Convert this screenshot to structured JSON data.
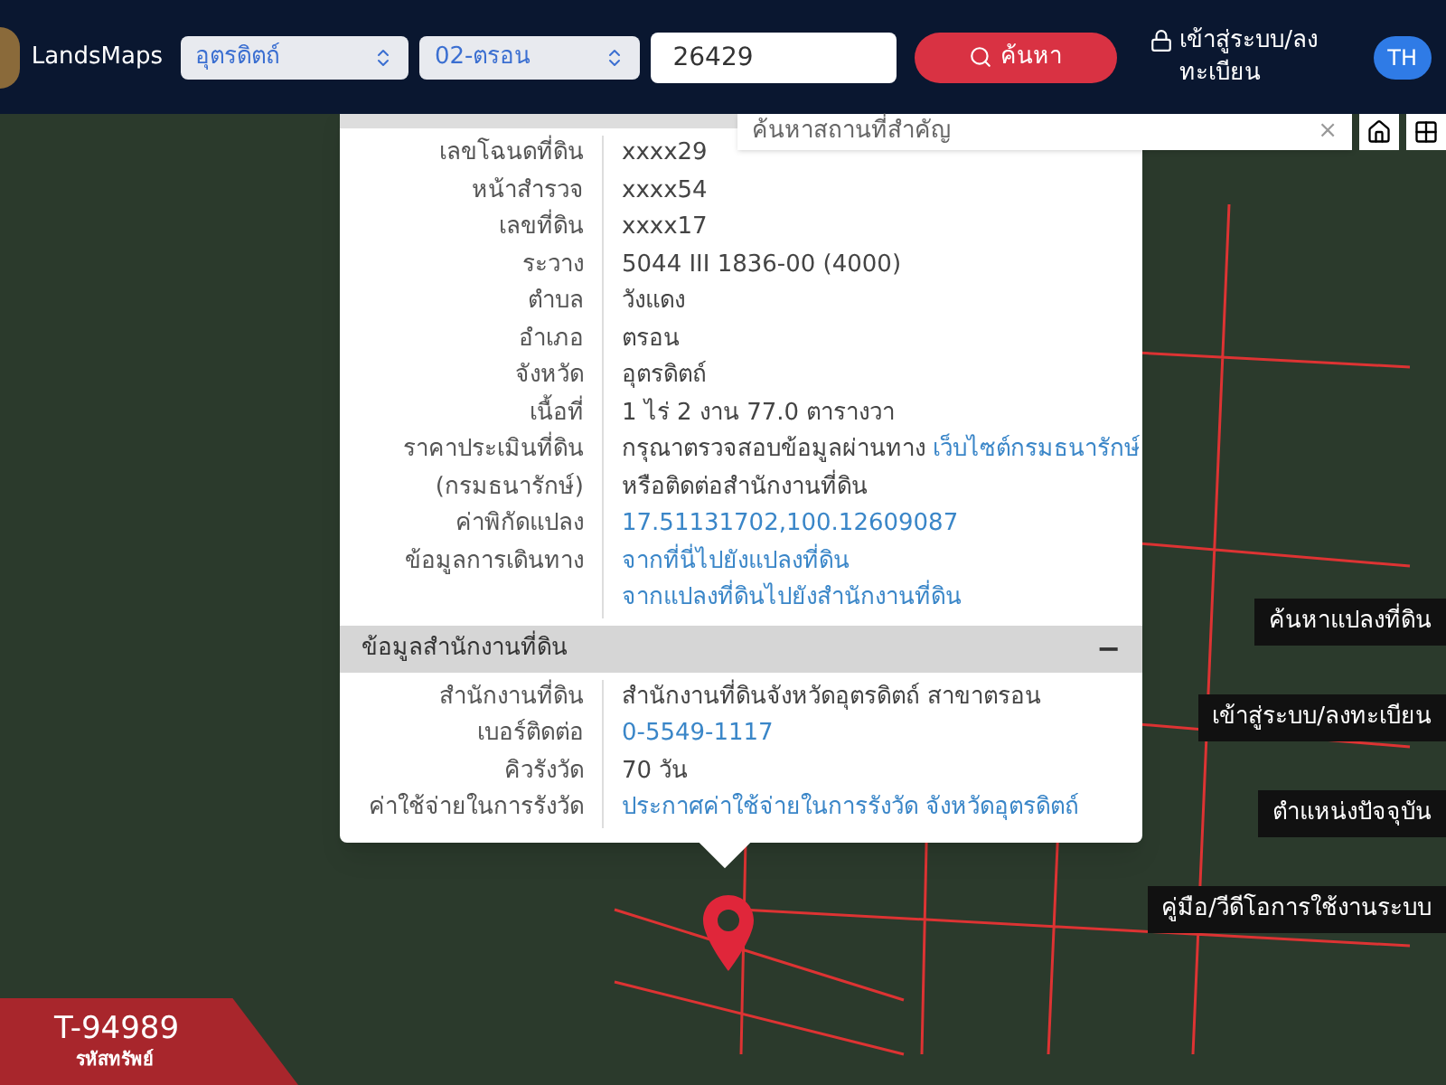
{
  "navbar": {
    "brand": "LandsMaps",
    "province": "อุตรดิตถ์",
    "district": "02-ตรอน",
    "parcel_number": "26429",
    "search_button": "ค้นหา",
    "login": "เข้าสู่ระบบ/ลงทะเบียน",
    "language": "TH"
  },
  "place_search": {
    "placeholder": "ค้นหาสถานที่สำคัญ",
    "clear": "×"
  },
  "parcel_info": {
    "rows": [
      {
        "label": "เลขโฉนดที่ดิน",
        "lines": [
          [
            {
              "kind": "text",
              "text": "xxxx29"
            }
          ]
        ]
      },
      {
        "label": "หน้าสำรวจ",
        "lines": [
          [
            {
              "kind": "text",
              "text": "xxxx54"
            }
          ]
        ]
      },
      {
        "label": "เลขที่ดิน",
        "lines": [
          [
            {
              "kind": "text",
              "text": "xxxx17"
            }
          ]
        ]
      },
      {
        "label": "ระวาง",
        "lines": [
          [
            {
              "kind": "text",
              "text": "5044 III 1836-00 (4000)"
            }
          ]
        ]
      },
      {
        "label": "ตำบล",
        "lines": [
          [
            {
              "kind": "text",
              "text": "วังแดง"
            }
          ]
        ]
      },
      {
        "label": "อำเภอ",
        "lines": [
          [
            {
              "kind": "text",
              "text": "ตรอน"
            }
          ]
        ]
      },
      {
        "label": "จังหวัด",
        "lines": [
          [
            {
              "kind": "text",
              "text": "อุตรดิตถ์"
            }
          ]
        ]
      },
      {
        "label": "เนื้อที่",
        "lines": [
          [
            {
              "kind": "text",
              "text": "1 ไร่ 2 งาน 77.0 ตารางวา"
            }
          ]
        ]
      },
      {
        "label": "ราคาประเมินที่ดิน",
        "lines": [
          [
            {
              "kind": "text",
              "text": "กรุณาตรวจสอบข้อมูลผ่านทาง"
            },
            {
              "kind": "link",
              "text": "เว็บไซต์กรมธนารักษ์"
            }
          ]
        ]
      },
      {
        "label": "(กรมธนารักษ์)",
        "lines": [
          [
            {
              "kind": "text",
              "text": "หรือติดต่อสำนักงานที่ดิน"
            }
          ]
        ]
      },
      {
        "label": "ค่าพิกัดแปลง",
        "lines": [
          [
            {
              "kind": "link",
              "text": "17.51131702,100.12609087"
            }
          ]
        ]
      },
      {
        "label": "ข้อมูลการเดินทาง",
        "lines": [
          [
            {
              "kind": "link",
              "text": "จากที่นี่ไปยังแปลงที่ดิน"
            }
          ],
          [
            {
              "kind": "link",
              "text": "จากแปลงที่ดินไปยังสำนักงานที่ดิน"
            }
          ]
        ]
      }
    ]
  },
  "office_info": {
    "title": "ข้อมูลสำนักงานที่ดิน",
    "toggle": "−",
    "rows": [
      {
        "label": "สำนักงานที่ดิน",
        "lines": [
          [
            {
              "kind": "text",
              "text": "สำนักงานที่ดินจังหวัดอุตรดิตถ์ สาขาตรอน"
            }
          ]
        ]
      },
      {
        "label": "เบอร์ติดต่อ",
        "lines": [
          [
            {
              "kind": "link",
              "text": "0-5549-1117"
            }
          ]
        ]
      },
      {
        "label": "คิวรังวัด",
        "lines": [
          [
            {
              "kind": "text",
              "text": "70 วัน"
            }
          ]
        ]
      },
      {
        "label": "ค่าใช้จ่ายในการรังวัด",
        "lines": [
          [
            {
              "kind": "link",
              "text": "ประกาศค่าใช้จ่ายในการรังวัด จังหวัดอุตรดิตถ์"
            }
          ]
        ]
      }
    ]
  },
  "side_buttons": [
    "ค้นหาแปลงที่ดิน",
    "เข้าสู่ระบบ/ลงทะเบียน",
    "ตำแหน่งปัจจุบัน",
    "คู่มือ/วีดีโอการใช้งานระบบ"
  ],
  "property_code": {
    "code": "T-94989",
    "label": "รหัสทรัพย์"
  }
}
